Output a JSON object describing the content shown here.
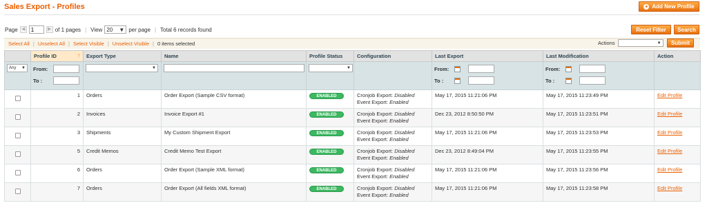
{
  "header": {
    "title": "Sales Export - Profiles",
    "add_button": "Add New Profile"
  },
  "pager": {
    "page_label": "Page",
    "current_page": "1",
    "of_pages": "of 1 pages",
    "view_label": "View",
    "per_page_value": "20",
    "per_page_label": "per page",
    "records_found": "Total 6 records found",
    "reset_filter": "Reset Filter",
    "search": "Search"
  },
  "massaction": {
    "select_all": "Select All",
    "unselect_all": "Unselect All",
    "select_visible": "Select Visible",
    "unselect_visible": "Unselect Visible",
    "items_selected": "0 items selected",
    "actions_label": "Actions",
    "actions_value": "",
    "submit": "Submit"
  },
  "columns": {
    "profile_id": "Profile ID",
    "export_type": "Export Type",
    "name": "Name",
    "profile_status": "Profile Status",
    "configuration": "Configuration",
    "last_export": "Last Export",
    "last_modification": "Last Modification",
    "action": "Action"
  },
  "filters": {
    "any": "Any",
    "from": "From:",
    "to": "To :"
  },
  "rows": [
    {
      "id": "1",
      "type": "Orders",
      "name": "Order Export (Sample CSV format)",
      "status": "ENABLED",
      "cron_label": "Cronjob Export:",
      "cron_value": "Disabled",
      "event_label": "Event Export:",
      "event_value": "Enabled",
      "last_export": "May 17, 2015 11:21:06 PM",
      "last_mod": "May 17, 2015 11:23:49 PM",
      "action": "Edit Profile"
    },
    {
      "id": "2",
      "type": "Invoices",
      "name": "Invoice Export #1",
      "status": "ENABLED",
      "cron_label": "Cronjob Export:",
      "cron_value": "Disabled",
      "event_label": "Event Export:",
      "event_value": "Enabled",
      "last_export": "Dec 23, 2012 8:50:50 PM",
      "last_mod": "May 17, 2015 11:23:51 PM",
      "action": "Edit Profile"
    },
    {
      "id": "3",
      "type": "Shipments",
      "name": "My Custom Shipment Export",
      "status": "ENABLED",
      "cron_label": "Cronjob Export:",
      "cron_value": "Disabled",
      "event_label": "Event Export:",
      "event_value": "Enabled",
      "last_export": "May 17, 2015 11:21:06 PM",
      "last_mod": "May 17, 2015 11:23:53 PM",
      "action": "Edit Profile"
    },
    {
      "id": "5",
      "type": "Credit Memos",
      "name": "Credit Memo Test Export",
      "status": "ENABLED",
      "cron_label": "Cronjob Export:",
      "cron_value": "Disabled",
      "event_label": "Event Export:",
      "event_value": "Enabled",
      "last_export": "Dec 23, 2012 8:49:04 PM",
      "last_mod": "May 17, 2015 11:23:55 PM",
      "action": "Edit Profile"
    },
    {
      "id": "6",
      "type": "Orders",
      "name": "Order Export (Sample XML format)",
      "status": "ENABLED",
      "cron_label": "Cronjob Export:",
      "cron_value": "Disabled",
      "event_label": "Event Export:",
      "event_value": "Enabled",
      "last_export": "May 17, 2015 11:21:06 PM",
      "last_mod": "May 17, 2015 11:23:56 PM",
      "action": "Edit Profile"
    },
    {
      "id": "7",
      "type": "Orders",
      "name": "Order Export (All fields XML format)",
      "status": "ENABLED",
      "cron_label": "Cronjob Export:",
      "cron_value": "Disabled",
      "event_label": "Event Export:",
      "event_value": "Enabled",
      "last_export": "May 17, 2015 11:21:06 PM",
      "last_mod": "May 17, 2015 11:23:58 PM",
      "action": "Edit Profile"
    }
  ],
  "colors": {
    "accent": "#eb5e00",
    "button": "#e8710f",
    "enabled_badge": "#3cb861",
    "filter_row": "#d7e3e5"
  }
}
